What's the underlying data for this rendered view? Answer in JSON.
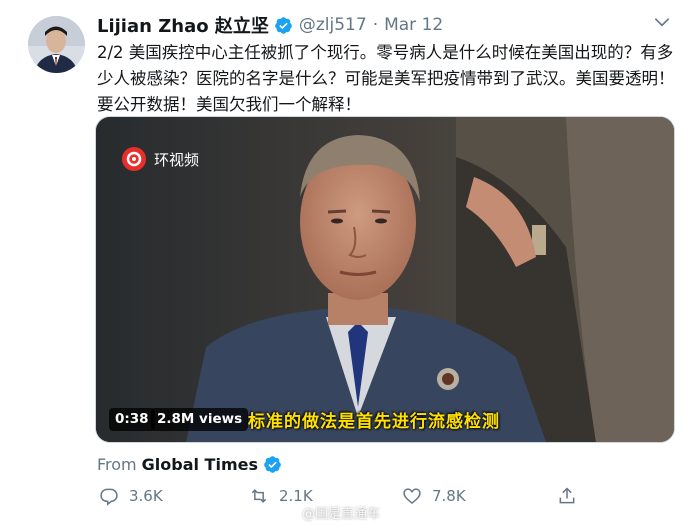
{
  "tweet": {
    "author_name": "Lijian Zhao 赵立坚",
    "handle": "@zlj517",
    "separator": "·",
    "date": "Mar 12",
    "text": "2/2 美国疾控中心主任被抓了个现行。零号病人是什么时候在美国出现的？有多少人被感染？医院的名字是什么？可能是美军把疫情带到了武汉。美国要透明！要公开数据！美国欠我们一个解释！"
  },
  "media": {
    "logo_text": "环视频",
    "duration": "0:38",
    "views": "2.8M views",
    "subtitle": "标准的做法是首先进行流感检测"
  },
  "source": {
    "prefix": "From",
    "name": "Global Times"
  },
  "actions": {
    "reply_count": "3.6K",
    "retweet_count": "2.1K",
    "like_count": "7.8K"
  },
  "watermark": "@国是直通车",
  "colors": {
    "verified_blue": "#1da1f2",
    "meta_gray": "#657786",
    "subtitle_yellow": "#ffe000",
    "logo_red": "#e8302a"
  }
}
